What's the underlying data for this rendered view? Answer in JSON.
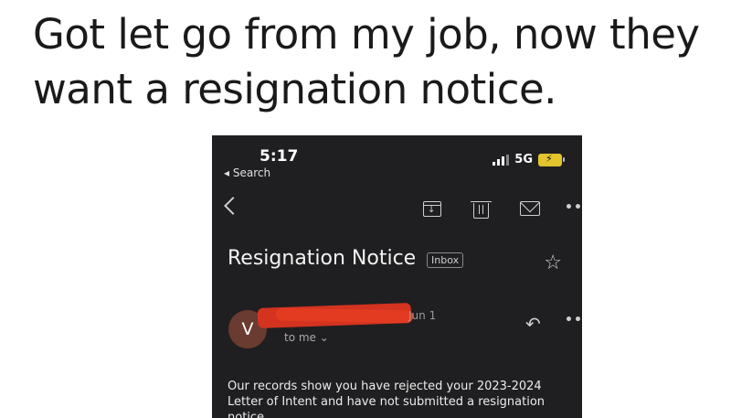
{
  "post": {
    "title_line1": "Got let go from my job, now they",
    "title_line2": "want a resignation notice."
  },
  "status_bar": {
    "time": "5:17",
    "back_label": "◂ Search",
    "network": "5G"
  },
  "email": {
    "subject": "Resignation Notice",
    "label": "Inbox",
    "sender_initial": "V",
    "date": "Jun 1",
    "recipient": "to me ⌄",
    "body": "Our records show you have rejected your 2023-2024 Letter of Intent and have not submitted a resignation notice."
  },
  "icons": [
    "back-chevron-icon",
    "archive-icon",
    "trash-icon",
    "mail-icon",
    "more-icon",
    "star-icon",
    "reply-icon",
    "signal-icon",
    "battery-icon"
  ]
}
